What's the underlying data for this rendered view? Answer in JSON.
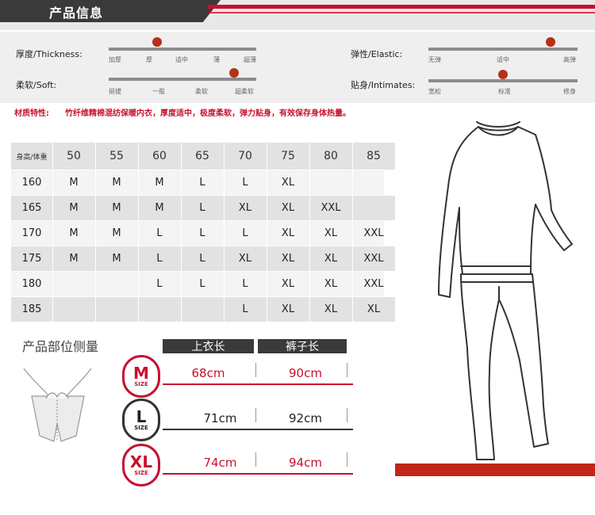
{
  "header": {
    "title": "产品信息"
  },
  "attributes": [
    {
      "label": "厚度/Thickness:",
      "ticks": [
        "加厚",
        "厚",
        "适中",
        "薄",
        "超薄"
      ],
      "level": 0.33
    },
    {
      "label": "柔软/Soft:",
      "ticks": [
        "挺拔",
        "一般",
        "柔软",
        "超柔软"
      ],
      "level": 0.85
    },
    {
      "label": "弹性/Elastic:",
      "ticks": [
        "无弹",
        "适中",
        "高弹"
      ],
      "level": 0.82
    },
    {
      "label": "贴身/Intimates:",
      "ticks": [
        "宽松",
        "标准",
        "修身"
      ],
      "level": 0.5
    }
  ],
  "material": {
    "label": "材质特性:",
    "text": "竹纤维精棉混纺保暖内衣，厚度适中，极度柔软，弹力贴身，有效保存身体热量。"
  },
  "size_table": {
    "corner": "身高/体重",
    "weights": [
      "50",
      "55",
      "60",
      "65",
      "70",
      "75",
      "80",
      "85"
    ],
    "rows": [
      {
        "height": "160",
        "sizes": [
          "M",
          "M",
          "M",
          "L",
          "L",
          "XL",
          "",
          ""
        ]
      },
      {
        "height": "165",
        "sizes": [
          "M",
          "M",
          "M",
          "L",
          "XL",
          "XL",
          "XXL",
          ""
        ]
      },
      {
        "height": "170",
        "sizes": [
          "M",
          "M",
          "L",
          "L",
          "L",
          "XL",
          "XL",
          "XXL"
        ]
      },
      {
        "height": "175",
        "sizes": [
          "M",
          "M",
          "L",
          "L",
          "XL",
          "XL",
          "XL",
          "XXL"
        ]
      },
      {
        "height": "180",
        "sizes": [
          "",
          "",
          "L",
          "L",
          "L",
          "XL",
          "XL",
          "XXL"
        ]
      },
      {
        "height": "185",
        "sizes": [
          "",
          "",
          "",
          "",
          "L",
          "XL",
          "XL",
          "XL"
        ]
      }
    ]
  },
  "measurement": {
    "title": "产品部位侧量",
    "columns": [
      "上衣长",
      "裤子长"
    ],
    "size_word": "SIZE",
    "rows": [
      {
        "size": "M",
        "top": "68cm",
        "pants": "90cm",
        "color": "#c8102e"
      },
      {
        "size": "L",
        "top": "71cm",
        "pants": "92cm",
        "color": "#222222"
      },
      {
        "size": "XL",
        "top": "74cm",
        "pants": "94cm",
        "color": "#c8102e"
      }
    ]
  }
}
